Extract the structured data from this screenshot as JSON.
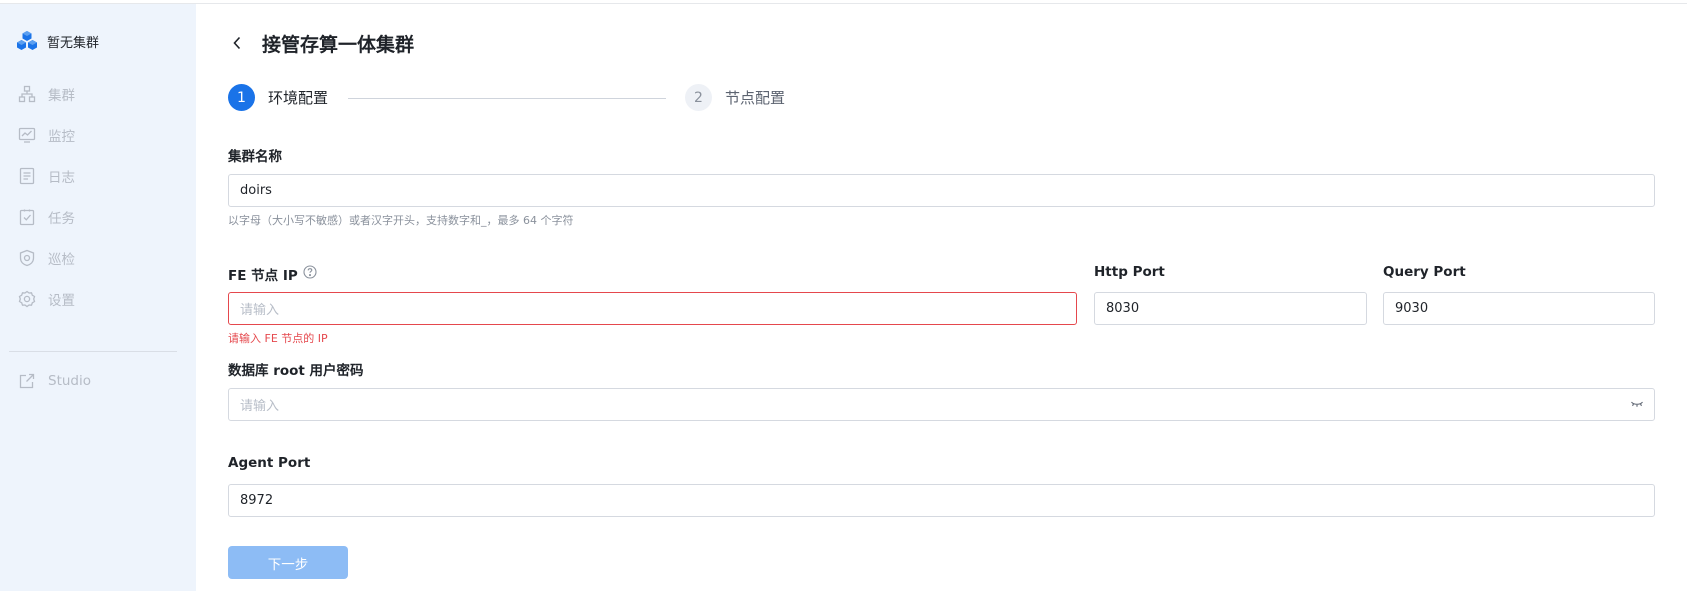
{
  "brand": {
    "title": "暂无集群",
    "icon": "cubes-logo-icon",
    "color": "#1a73e8"
  },
  "sidebar": {
    "items": [
      {
        "label": "集群",
        "icon": "cluster-icon"
      },
      {
        "label": "监控",
        "icon": "monitor-icon"
      },
      {
        "label": "日志",
        "icon": "log-icon"
      },
      {
        "label": "任务",
        "icon": "task-icon"
      },
      {
        "label": "巡检",
        "icon": "inspection-icon"
      },
      {
        "label": "设置",
        "icon": "gear-icon"
      }
    ],
    "studio": {
      "label": "Studio",
      "icon": "external-link-icon"
    }
  },
  "header": {
    "title": "接管存算一体集群",
    "back_icon": "chevron-left-icon"
  },
  "steps": [
    {
      "number": "1",
      "label": "环境配置",
      "state": "active"
    },
    {
      "number": "2",
      "label": "节点配置",
      "state": "pending"
    }
  ],
  "form": {
    "cluster_name": {
      "label": "集群名称",
      "value": "doirs",
      "hint": "以字母（大小写不敏感）或者汉字开头，支持数字和_，最多 64 个字符"
    },
    "fe_ip": {
      "label": "FE 节点 IP",
      "help_icon": "question-circle-icon",
      "placeholder": "请输入",
      "value": "",
      "error": "请输入 FE 节点的 IP"
    },
    "http_port": {
      "label": "Http Port",
      "value": "8030"
    },
    "query_port": {
      "label": "Query Port",
      "value": "9030"
    },
    "root_password": {
      "label": "数据库 root 用户密码",
      "placeholder": "请输入",
      "value": "",
      "icon": "eye-closed-icon"
    },
    "agent_port": {
      "label": "Agent Port",
      "value": "8972"
    }
  },
  "actions": {
    "next_label": "下一步"
  },
  "colors": {
    "primary": "#1a73e8",
    "error": "#e5484d",
    "sidebar_bg": "#eef4fc",
    "disabled_button": "#8dbcf5"
  }
}
